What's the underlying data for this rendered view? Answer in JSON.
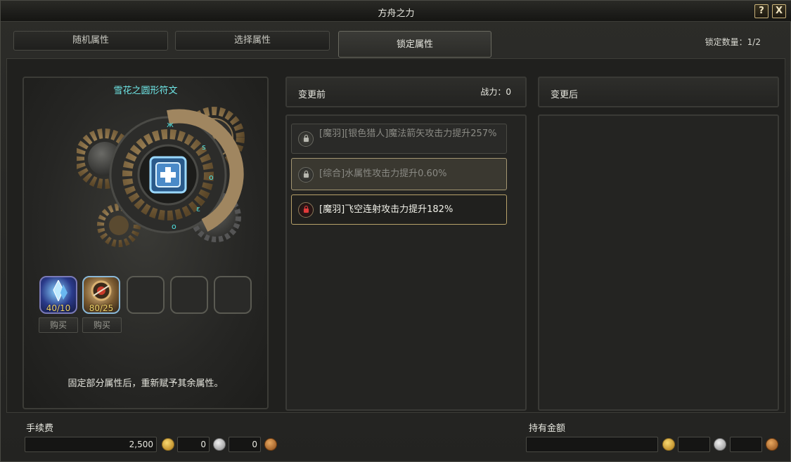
{
  "window": {
    "title": "方舟之力",
    "help_label": "?",
    "close_label": "X"
  },
  "tabs": [
    {
      "label": "随机属性",
      "active": false
    },
    {
      "label": "选择属性",
      "active": false
    },
    {
      "label": "锁定属性",
      "active": true
    }
  ],
  "lock_count": "锁定数量：1/2",
  "rune": {
    "name": "雪花之圆形符文",
    "slots": [
      {
        "icon": "crystal-icon",
        "value": "40/10"
      },
      {
        "icon": "compass-icon",
        "value": "80/25"
      },
      {
        "icon": "empty-slot",
        "value": ""
      },
      {
        "icon": "empty-slot",
        "value": ""
      },
      {
        "icon": "empty-slot",
        "value": ""
      }
    ],
    "buy_labels": [
      "购买",
      "购买"
    ],
    "description": "固定部分属性后，重新赋予其余属性。"
  },
  "before": {
    "label": "变更前",
    "power": "战力：0",
    "attributes": [
      {
        "text": "[魔羽][银色猎人]魔法箭矢攻击力提升257%",
        "locked": false
      },
      {
        "text": "[综合]水属性攻击力提升0.60%",
        "locked": false
      },
      {
        "text": "[魔羽]飞空连射攻击力提升182%",
        "locked": true
      }
    ]
  },
  "after": {
    "label": "变更后"
  },
  "fee": {
    "label": "手续费",
    "gold": "2,500",
    "silver": "0",
    "copper": "0"
  },
  "held": {
    "label": "持有金额",
    "gold": "",
    "silver": "",
    "copper": ""
  },
  "colors": {
    "rune_name": "#6fe8e8",
    "slot_value": "#f0d46a",
    "locked_border": "#b8a26a",
    "lock_red": "#e23a3a"
  }
}
